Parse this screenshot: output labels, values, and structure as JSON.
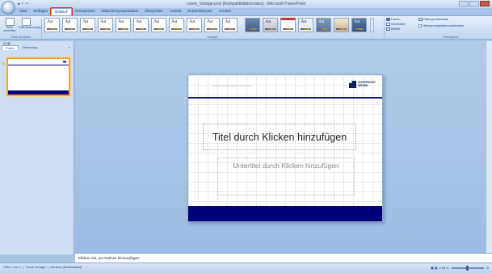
{
  "window": {
    "title": "Leere_Vorlage.potx [Kompatibilitätsmodus] - Microsoft PowerPoint"
  },
  "ribbon": {
    "tabs": [
      "Start",
      "Einfügen",
      "Entwurf",
      "Animationen",
      "Bildschirmpräsentation",
      "Überprüfen",
      "Ansicht",
      "Entwicklertools",
      "Acrobat"
    ],
    "active_tab": "Entwurf",
    "page_setup": {
      "btn1": "Seite einrichten",
      "btn2": "Folienausrichtung",
      "label": "Seite einrichten"
    },
    "themes_label": "Designs",
    "theme_glyph": "Aa",
    "background": {
      "colors": "Farben",
      "fonts": "Schriftarten",
      "effects": "Effekte",
      "styles": "Hintergrundformate",
      "hide": "Hintergrundgrafiken ausblenden",
      "label": "Hintergrund"
    }
  },
  "left_panel": {
    "tab_slides": "Folien",
    "tab_outline": "Gliederung",
    "slide_number": "1",
    "close": "×"
  },
  "slide": {
    "logo_line1": "UNIVERSITÄT",
    "logo_line2": "SIEGEN",
    "title_placeholder": "Titel durch Klicken hinzufügen",
    "subtitle_placeholder": "Untertitel durch Klicken hinzufügen"
  },
  "notes": {
    "placeholder": "Klicken Sie, um Notizen hinzuzufügen"
  },
  "status": {
    "slide_info": "Folie 1 von 1",
    "theme": "\"Leere Vorlage\"",
    "language": "Deutsch (Deutschland)",
    "zoom": "68 %"
  },
  "colors": {
    "accent_band": "#00007a",
    "active_tab_highlight": "#d02a22",
    "selected_thumb": "#f5a332"
  }
}
